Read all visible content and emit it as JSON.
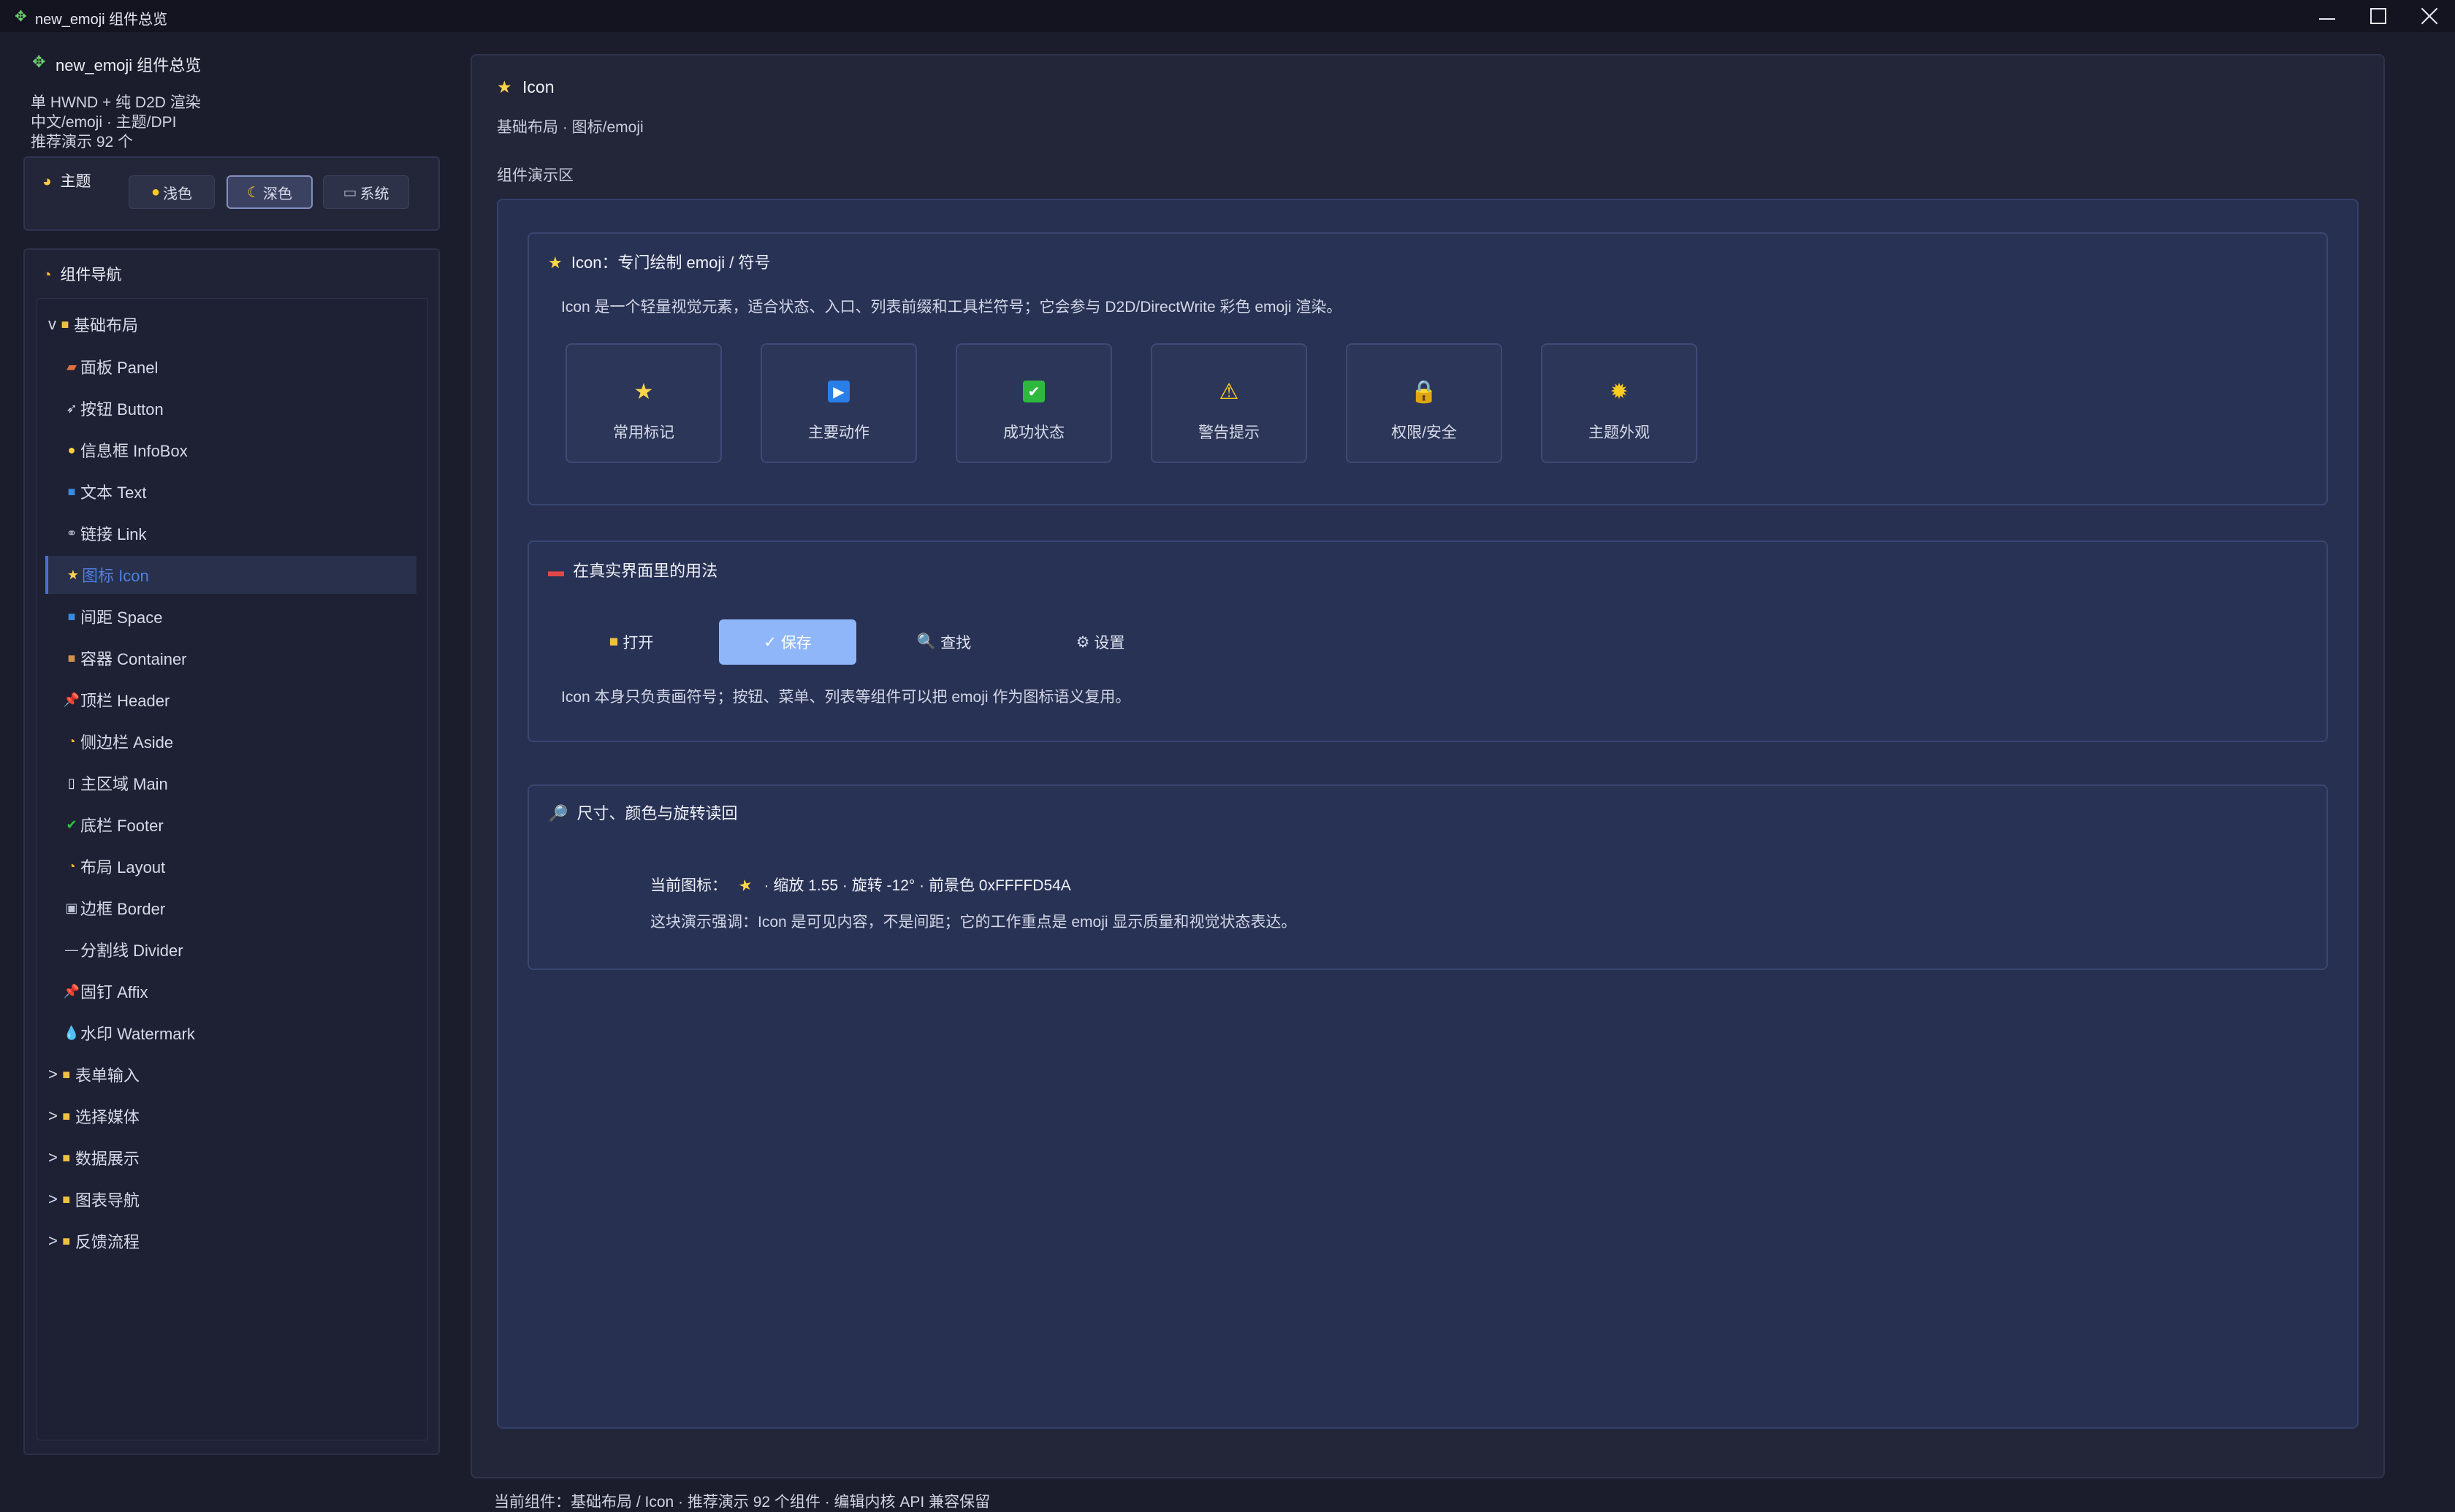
{
  "window": {
    "title": "new_emoji 组件总览",
    "app_icon": "puzzle-icon"
  },
  "sidebar": {
    "title": "new_emoji 组件总览",
    "info_lines": [
      "单 HWND + 纯 D2D 渲染",
      "中文/emoji · 主题/DPI",
      "推荐演示 92 个"
    ],
    "theme": {
      "label": "主题",
      "options": [
        {
          "label": "浅色",
          "icon": "sun-icon"
        },
        {
          "label": "深色",
          "icon": "moon-icon",
          "selected": true
        },
        {
          "label": "系统",
          "icon": "laptop-icon"
        }
      ]
    },
    "nav": {
      "title": "组件导航",
      "groups": [
        {
          "label": "基础布局",
          "marker": "v",
          "expanded": true
        },
        {
          "label": "表单输入",
          "marker": ">"
        },
        {
          "label": "选择媒体",
          "marker": ">"
        },
        {
          "label": "数据展示",
          "marker": ">"
        },
        {
          "label": "图表导航",
          "marker": ">"
        },
        {
          "label": "反馈流程",
          "marker": ">"
        }
      ],
      "items": [
        {
          "label": "面板 Panel",
          "icon": "brick-icon"
        },
        {
          "label": "按钮 Button",
          "icon": "rocket-icon"
        },
        {
          "label": "信息框 InfoBox",
          "icon": "bulb-icon"
        },
        {
          "label": "文本 Text",
          "icon": "text-icon"
        },
        {
          "label": "链接 Link",
          "icon": "link-icon"
        },
        {
          "label": "图标 Icon",
          "icon": "star-icon",
          "active": true
        },
        {
          "label": "间距 Space",
          "icon": "space-icon"
        },
        {
          "label": "容器 Container",
          "icon": "box-icon"
        },
        {
          "label": "顶栏 Header",
          "icon": "pin-icon"
        },
        {
          "label": "侧边栏 Aside",
          "icon": "clock-icon"
        },
        {
          "label": "主区域 Main",
          "icon": "page-icon"
        },
        {
          "label": "底栏 Footer",
          "icon": "check-icon"
        },
        {
          "label": "布局 Layout",
          "icon": "clock-icon"
        },
        {
          "label": "边框 Border",
          "icon": "frame-icon"
        },
        {
          "label": "分割线 Divider",
          "icon": "dash-icon"
        },
        {
          "label": "固钉 Affix",
          "icon": "pin-icon"
        },
        {
          "label": "水印 Watermark",
          "icon": "droplet-icon"
        }
      ]
    }
  },
  "main": {
    "title": "Icon",
    "breadcrumb": "基础布局 · 图标/emoji",
    "demo_label": "组件演示区",
    "card1": {
      "title": "Icon：专门绘制 emoji / 符号",
      "desc": "Icon 是一个轻量视觉元素，适合状态、入口、列表前缀和工具栏符号；它会参与 D2D/DirectWrite 彩色 emoji 渲染。",
      "tiles": [
        {
          "label": "常用标记",
          "icon": "star-icon"
        },
        {
          "label": "主要动作",
          "icon": "play-icon"
        },
        {
          "label": "成功状态",
          "icon": "check-icon"
        },
        {
          "label": "警告提示",
          "icon": "warning-icon"
        },
        {
          "label": "权限/安全",
          "icon": "lock-icon"
        },
        {
          "label": "主题外观",
          "icon": "sun-icon"
        }
      ]
    },
    "card2": {
      "title": "在真实界面里的用法",
      "buttons": [
        {
          "label": "打开",
          "icon": "folder-icon"
        },
        {
          "label": "保存",
          "icon": "check-icon",
          "primary": true
        },
        {
          "label": "查找",
          "icon": "magnifier-icon"
        },
        {
          "label": "设置",
          "icon": "gear-icon"
        }
      ],
      "desc": "Icon 本身只负责画符号；按钮、菜单、列表等组件可以把 emoji 作为图标语义复用。"
    },
    "card3": {
      "title": "尺寸、颜色与旋转读回",
      "current_label": "当前图标：",
      "current_detail": "· 缩放 1.55 · 旋转 -12° · 前景色 0xFFFFD54A",
      "note": "这块演示强调：Icon 是可见内容，不是间距；它的工作重点是 emoji 显示质量和视觉状态表达。"
    }
  },
  "status_bar": "当前组件：基础布局 / Icon · 推荐演示 92 个组件 · 编辑内核 API 兼容保留",
  "colors": {
    "background": "#1b1d2c",
    "accent": "#4e7fe0",
    "primary_button": "#8fb6f8",
    "star": "#ffd54a"
  }
}
